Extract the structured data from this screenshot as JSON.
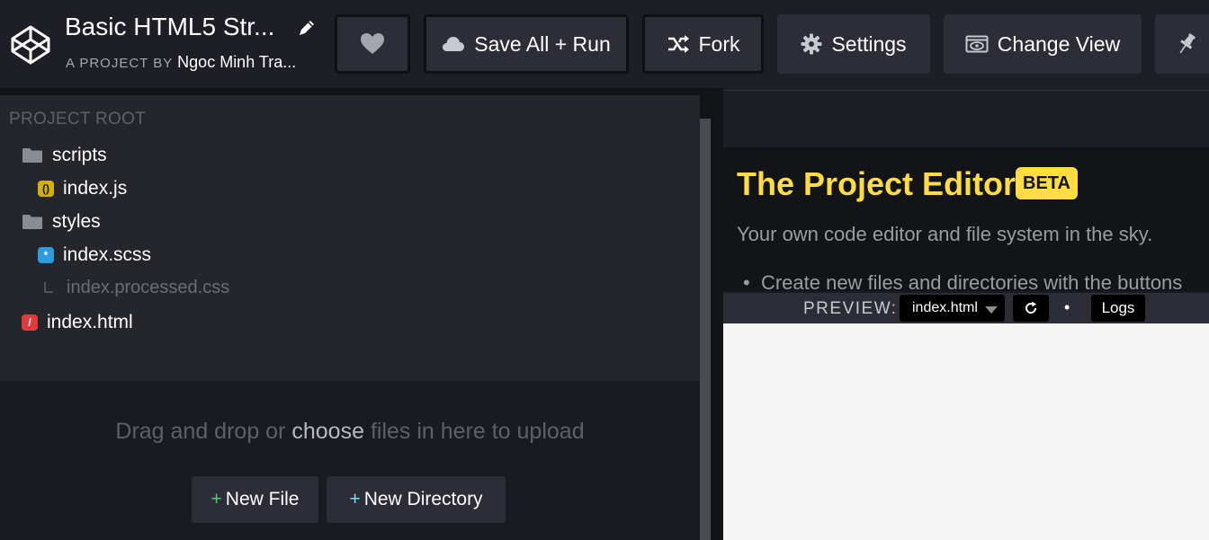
{
  "header": {
    "title": "Basic HTML5 Str...",
    "byline_prefix": "A PROJECT BY",
    "author": "Ngoc Minh Tra...",
    "save_label": "Save All + Run",
    "fork_label": "Fork",
    "settings_label": "Settings",
    "change_view_label": "Change View"
  },
  "sidebar": {
    "root_label": "PROJECT ROOT",
    "items": [
      {
        "label": "scripts",
        "icon": "folder-icon"
      },
      {
        "label": "index.js",
        "icon": "js-file-icon"
      },
      {
        "label": "styles",
        "icon": "folder-icon"
      },
      {
        "label": "index.scss",
        "icon": "scss-file-icon"
      },
      {
        "label": "index.processed.css",
        "icon": "processed-file-icon"
      },
      {
        "label": "index.html",
        "icon": "html-file-icon"
      }
    ],
    "upload": {
      "before": "Drag and drop or",
      "choose": "choose",
      "after": "files in here to upload"
    },
    "new_file_label": "New File",
    "new_directory_label": "New Directory"
  },
  "preview": {
    "doc_title": "The Project Editor!",
    "beta_label": "BETA",
    "doc_subtitle": "Your own code editor and file system in the sky.",
    "doc_bullet": "Create new files and directories with the buttons",
    "label": "PREVIEW:",
    "file_select": "index.html",
    "dot": "•",
    "logs_label": "Logs"
  },
  "colors": {
    "accent_yellow": "#ffdd40",
    "js_badge": "#d4b000",
    "scss_badge": "#2d9cdb",
    "html_badge": "#e03a3a",
    "new_file_plus": "#47cf73",
    "new_dir_plus": "#76daff"
  }
}
